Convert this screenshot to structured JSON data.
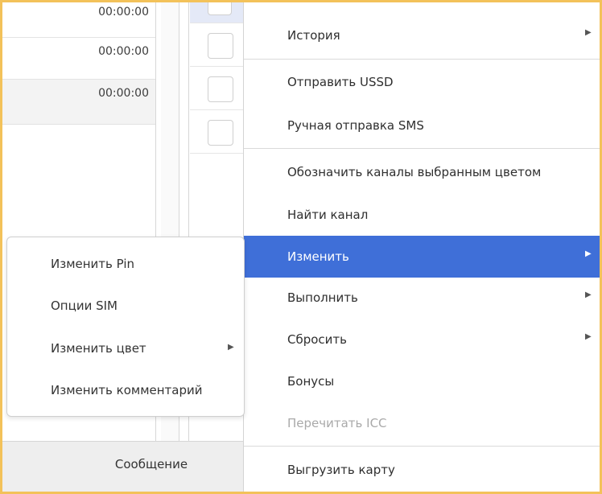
{
  "grid": {
    "times": [
      "00:00:00",
      "00:00:00",
      "00:00:00"
    ],
    "status_message": "Сообщение"
  },
  "context_menu": {
    "items": [
      {
        "label": "История",
        "submenu": true
      },
      {
        "label": "Отправить USSD"
      },
      {
        "label": "Ручная отправка SMS"
      },
      {
        "label": "Обозначить каналы выбранным цветом"
      },
      {
        "label": "Найти канал"
      },
      {
        "label": "Изменить",
        "submenu": true,
        "active": true
      },
      {
        "label": "Выполнить",
        "submenu": true
      },
      {
        "label": "Сбросить",
        "submenu": true
      },
      {
        "label": "Бонусы"
      },
      {
        "label": "Перечитать ICC",
        "disabled": true
      },
      {
        "label": "Выгрузить карту"
      }
    ]
  },
  "submenu": {
    "items": [
      {
        "label": "Изменить Pin"
      },
      {
        "label": "Опции SIM"
      },
      {
        "label": "Изменить цвет",
        "submenu": true
      },
      {
        "label": "Изменить комментарий"
      }
    ]
  },
  "icons": {
    "submenu_arrow": "triangle-right-icon"
  },
  "colors": {
    "accent": "#3f6fd8",
    "frame": "#f3c25a",
    "disabled_text": "#a9a9a9"
  }
}
